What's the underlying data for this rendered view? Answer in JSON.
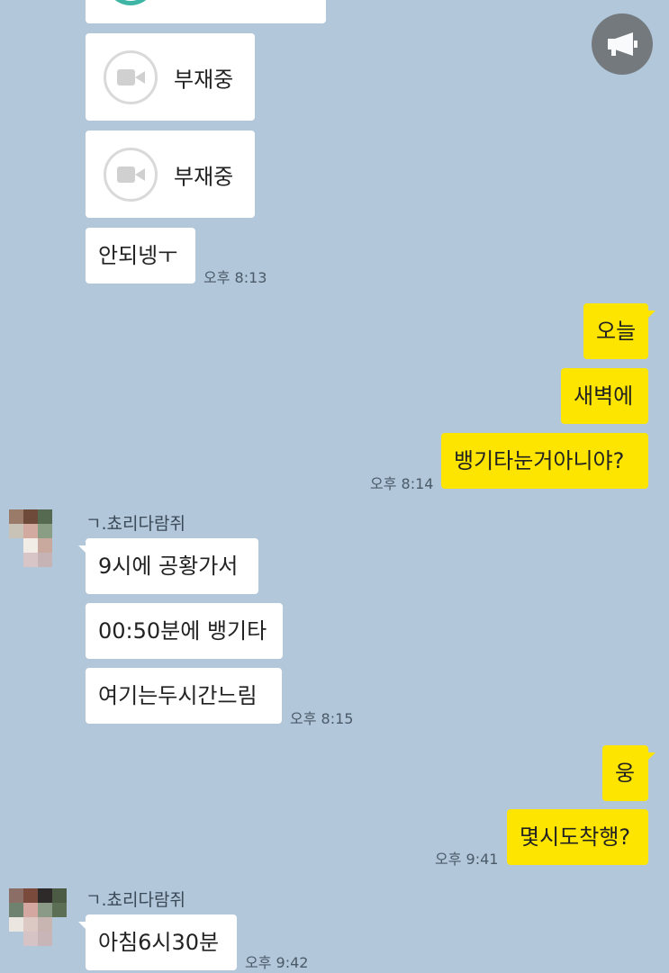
{
  "notice_button": {
    "icon": "megaphone-icon"
  },
  "calls": [
    {
      "label": "부재중",
      "icon": "video-call-icon"
    },
    {
      "label": "부재중",
      "icon": "video-call-icon"
    }
  ],
  "messages": {
    "m1": {
      "text": "안되넹ㅜ",
      "time": "오후 8:13"
    },
    "m2": {
      "text": "오늘"
    },
    "m3": {
      "text": "새벽에"
    },
    "m4": {
      "text": "뱅기타눈거아니야?",
      "time": "오후 8:14"
    },
    "sender1": "ㄱ.쵸리다람쥐",
    "m5": {
      "text": "9시에 공황가서"
    },
    "m6": {
      "text": "00:50분에 뱅기타"
    },
    "m7": {
      "text": "여기는두시간느림",
      "time": "오후 8:15"
    },
    "m8": {
      "text": "웅"
    },
    "m9": {
      "text": "몇시도착행?",
      "time": "오후 9:41"
    },
    "sender2": "ㄱ.쵸리다람쥐",
    "m10": {
      "text": "아침6시30분",
      "time": "오후 9:42"
    }
  },
  "colors": {
    "background": "#b2c7da",
    "outgoing": "#fee500",
    "incoming": "#ffffff"
  }
}
